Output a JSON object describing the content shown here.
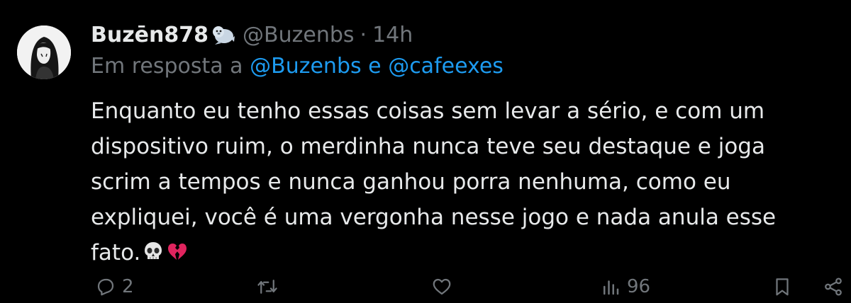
{
  "author": {
    "display_name": "Buzēn878",
    "handle": "@Buzenbs",
    "separator": "·",
    "time": "14h",
    "badge_icon": "seal-emoji-icon"
  },
  "reply_context": {
    "prefix": "Em resposta a",
    "mention_1": "@Buzenbs",
    "conjunction": "e",
    "mention_2": "@cafeexes"
  },
  "body": {
    "lines": [
      "Enquanto eu tenho essas coisas sem levar a sério, e com um",
      "dispositivo ruim, o merdinha nunca teve seu destaque e joga",
      "scrim a tempos e nunca ganhou porra nenhuma, como eu",
      "expliquei, você é uma vergonha nesse jogo e nada anula esse",
      "fato."
    ],
    "emojis": [
      "skull-emoji",
      "broken-heart-emoji"
    ]
  },
  "actions": {
    "reply_count": "2",
    "retweet_count": "",
    "like_count": "",
    "views_count": "96"
  },
  "colors": {
    "background": "#000000",
    "text": "#e7e9ea",
    "secondary": "#71767b",
    "link": "#1d9bf0"
  }
}
